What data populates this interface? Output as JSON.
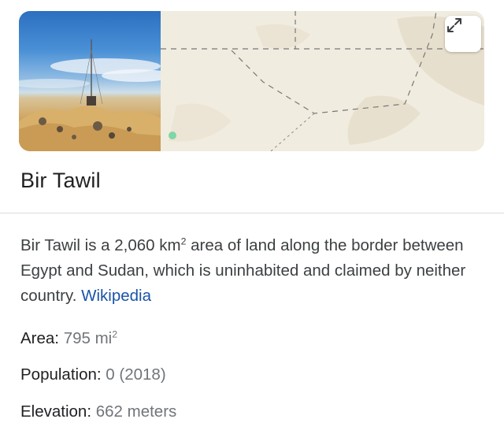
{
  "header": {
    "title": "Bir Tawil",
    "expand_icon": "expand-arrows-icon"
  },
  "description": {
    "text_part1": "Bir Tawil is a 2,060 km",
    "text_sup": "2",
    "text_part2": " area of land along the border between Egypt and Sudan, which is uninhabited and claimed by neither country. ",
    "source_link": "Wikipedia"
  },
  "facts": {
    "area": {
      "label": "Area:",
      "value": "795 mi",
      "value_sup": "2"
    },
    "population": {
      "label": "Population:",
      "value": "0 (2018)"
    },
    "elevation": {
      "label": "Elevation:",
      "value": "662 meters"
    }
  },
  "colors": {
    "link": "#1a53a8",
    "value_gray": "#70757a",
    "map_bg": "#f1ece0",
    "map_marker": "#7fd6a6"
  }
}
